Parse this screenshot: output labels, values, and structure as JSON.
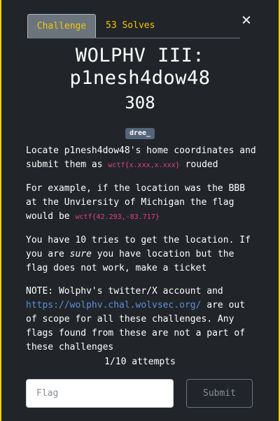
{
  "tabs": {
    "challenge_label": "Challenge",
    "solves_label": "53 Solves"
  },
  "close_icon": "×",
  "challenge": {
    "title_line1": "WOLPHV III:",
    "title_line2": "p1nesh4dow48",
    "points": "308",
    "author_tag": "dree_"
  },
  "description": {
    "p1_text": "Locate p1nesh4dow48's home coordinates and submit them as ",
    "p1_code": "wctf{x.xxx,x.xxx}",
    "p1_tail": " rouded",
    "p2_text": "For example, if the location was the BBB at the Unviersity of Michigan the flag would be ",
    "p2_code": "wctf{42.293,-83.717}",
    "p3_text": "You have 10 tries to get the location. If you are ",
    "p3_em": "sure",
    "p3_tail": " you have location but the flag does not work, make a ticket",
    "p4_text": "NOTE: Wolphv's twitter/X account and ",
    "p4_link": "https://wolphv.chal.wolvsec.org/",
    "p4_tail": " are out of scope for all these challenges. Any flags found from these are not a part of these challenges"
  },
  "attempts": "1/10 attempts",
  "form": {
    "flag_placeholder": "Flag",
    "submit_label": "Submit"
  },
  "colors": {
    "background": "#fdd000",
    "modal": "#212529",
    "accent": "#f2c600",
    "code": "#e83e8c",
    "link": "#5e8ed6"
  }
}
